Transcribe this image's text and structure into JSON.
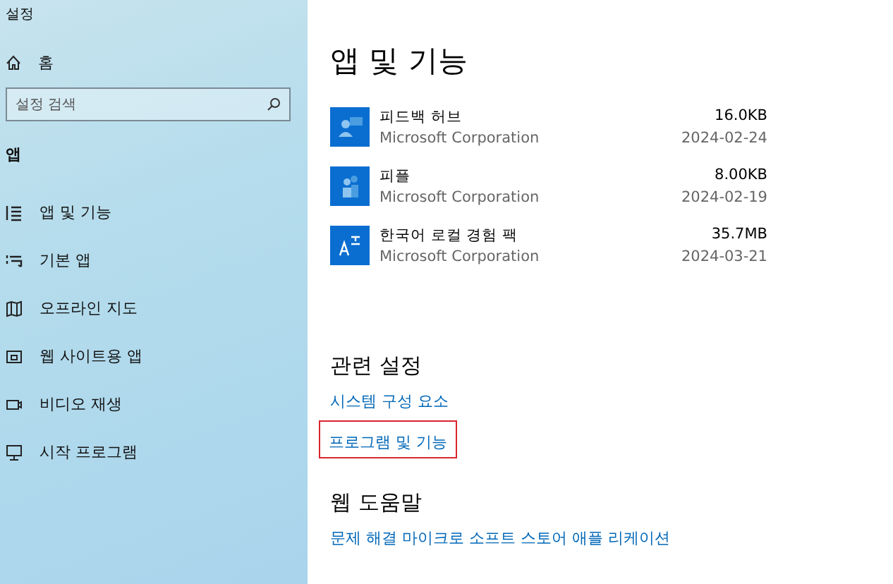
{
  "window": {
    "title": "설정"
  },
  "sidebar": {
    "home": {
      "label": "홈"
    },
    "search": {
      "placeholder": "설정 검색"
    },
    "section": "앱",
    "items": [
      {
        "label": "앱 및 기능"
      },
      {
        "label": "기본 앱"
      },
      {
        "label": "오프라인 지도"
      },
      {
        "label": "웹 사이트용 앱"
      },
      {
        "label": "비디오 재생"
      },
      {
        "label": "시작 프로그램"
      }
    ]
  },
  "content": {
    "title": "앱 및 기능",
    "apps": [
      {
        "name": "피드백 허브",
        "publisher": "Microsoft Corporation",
        "size": "16.0KB",
        "date": "2024-02-24"
      },
      {
        "name": "피플",
        "publisher": "Microsoft Corporation",
        "size": "8.00KB",
        "date": "2024-02-19"
      },
      {
        "name": "한국어 로컬 경험 팩",
        "publisher": "Microsoft Corporation",
        "size": "35.7MB",
        "date": "2024-03-21"
      }
    ],
    "related": {
      "heading": "관련 설정",
      "links": [
        {
          "label": "시스템 구성 요소"
        },
        {
          "label": "프로그램 및 기능",
          "highlighted": true
        }
      ]
    },
    "help": {
      "heading": "웹 도움말",
      "links": [
        {
          "label": "문제 해결 마이크로 소프트 스토어 애플 리케이션"
        }
      ]
    }
  }
}
